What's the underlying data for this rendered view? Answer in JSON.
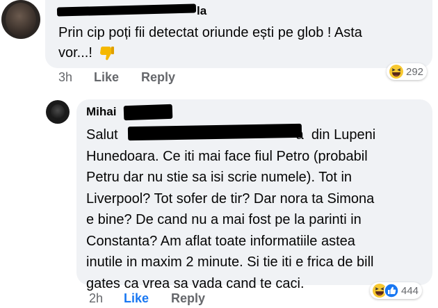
{
  "comment1": {
    "text_lines": [
      "Prin cip poți fii detectat oriunde ești pe glob ! Asta",
      "vor...!"
    ],
    "author_visible": "la",
    "time": "3h",
    "like_label": "Like",
    "reply_label": "Reply",
    "reaction_count": "292",
    "emoji_icon": "thumbs-down-icon",
    "reaction_icons": [
      "haha-icon"
    ]
  },
  "comment2": {
    "author_visible": "Mihai",
    "greeting_start": "Salut",
    "greeting_end": "a  din Lupeni",
    "text_lines": [
      "Hunedoara. Ce iti mai face fiul Petro (probabil",
      "Petru dar nu stie sa isi scrie numele). Tot in",
      "Liverpool? Tot sofer de tir? Dar nora ta Simona",
      "e bine? De cand nu a mai fost pe la parinti in",
      "Constanta? Am aflat toate informatiile astea",
      "inutile in maxim 2 minute. Si tie iti e frica de bill",
      "gates ca vrea sa vada cand te caci."
    ],
    "time": "2h",
    "like_label": "Like",
    "reply_label": "Reply",
    "reaction_count": "444",
    "reaction_icons": [
      "haha-icon",
      "like-icon"
    ]
  }
}
